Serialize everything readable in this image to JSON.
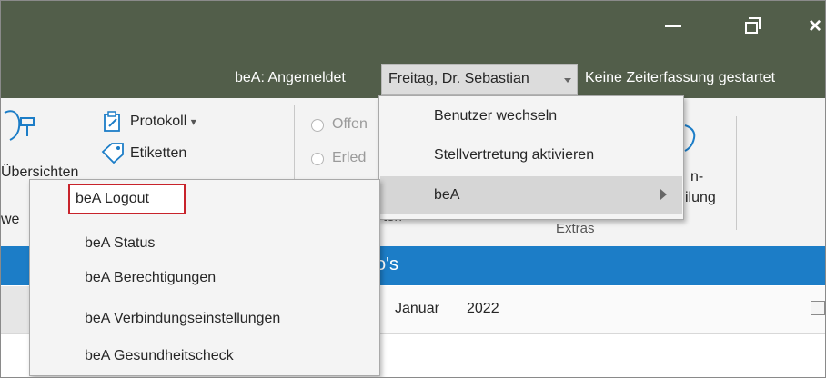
{
  "titlebar": {
    "minimize": "–",
    "restore": "restore",
    "close": "×",
    "bea_status": "beA: Angemeldet",
    "user_name": "Freitag, Dr. Sebastian",
    "time_tracking": "Keine Zeiterfassung gestartet"
  },
  "ribbon": {
    "protokoll": "Protokoll",
    "protokoll_caret": "▾",
    "etiketten": "Etiketten",
    "uebersichten": "Übersichten",
    "offen": "Offen",
    "erledigt": "Erled",
    "fragment_n": "n-",
    "fragment_ilung": "ilung",
    "extras": "Extras",
    "fragment_ten": "ten",
    "fragment_we": "we"
  },
  "bluebar": {
    "title": "o's"
  },
  "datebar": {
    "month": "Januar",
    "year": "2022"
  },
  "user_menu": {
    "items": [
      {
        "label": "Benutzer wechseln"
      },
      {
        "label": "Stellvertretung aktivieren"
      },
      {
        "label": "beA",
        "has_submenu": true
      }
    ]
  },
  "bea_menu": {
    "items": [
      {
        "label": "beA Logout",
        "highlighted": true
      },
      {
        "label": "beA Status"
      },
      {
        "label": "beA Berechtigungen"
      },
      {
        "label": "beA Verbindungseinstellungen"
      },
      {
        "label": "beA Gesundheitscheck"
      }
    ]
  },
  "colors": {
    "titlebar": "#525e4a",
    "accent_blue": "#1c7dc7",
    "highlight_border": "#c8232b"
  }
}
